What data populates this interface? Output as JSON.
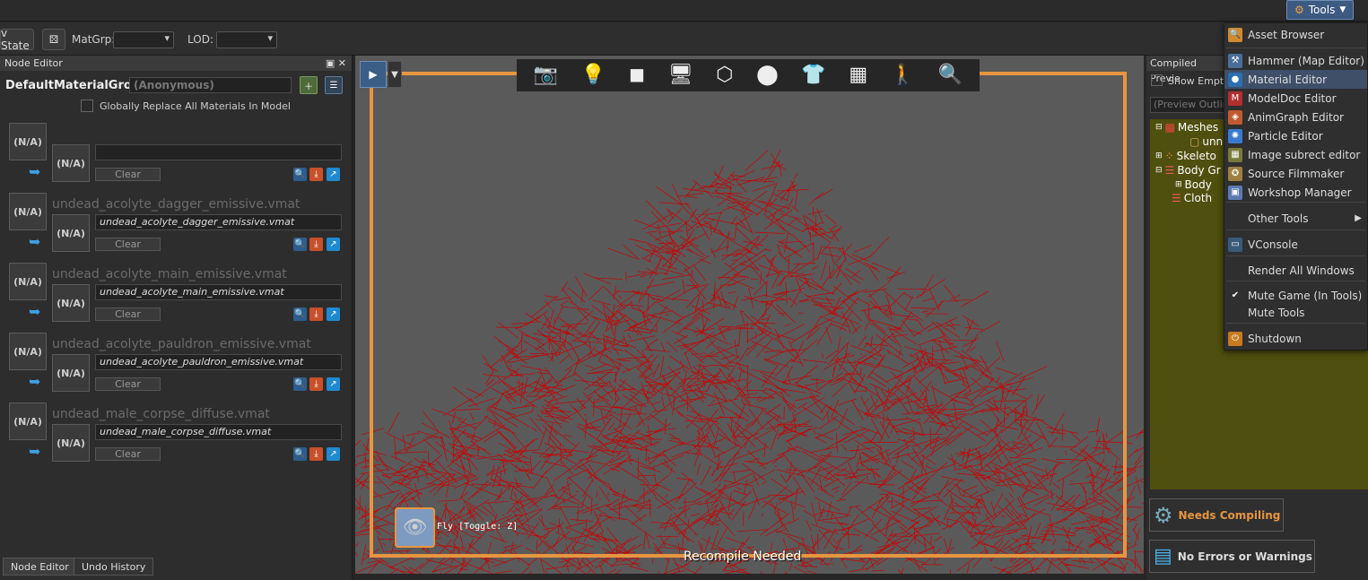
{
  "menubar": {
    "tools_label": "Tools"
  },
  "toolbar": {
    "state_label": "v State",
    "matgrp_label": "MatGrp:",
    "lod_label": "LOD:"
  },
  "node_editor": {
    "title": "Node Editor",
    "group_name": "DefaultMaterialGroup",
    "group_placeholder": "(Anonymous)",
    "replace_label": "Globally Replace All Materials In Model",
    "na_label": "(N/A)",
    "clear_label": "Clear",
    "entries": [
      {
        "name": "",
        "value": ""
      },
      {
        "name": "undead_acolyte_dagger_emissive.vmat",
        "value": "undead_acolyte_dagger_emissive.vmat"
      },
      {
        "name": "undead_acolyte_main_emissive.vmat",
        "value": "undead_acolyte_main_emissive.vmat"
      },
      {
        "name": "undead_acolyte_pauldron_emissive.vmat",
        "value": "undead_acolyte_pauldron_emissive.vmat"
      },
      {
        "name": "undead_male_corpse_diffuse.vmat",
        "value": "undead_male_corpse_diffuse.vmat"
      }
    ],
    "tabs": [
      "Node Editor",
      "Undo History"
    ]
  },
  "viewport": {
    "fly_label": "Fly [Toggle: Z]",
    "status": "Recompile Needed",
    "icons": [
      "camera-icon",
      "light-icon",
      "cube-icon",
      "monitor-icon",
      "wireframe-icon",
      "shapes-icon",
      "shirt-icon",
      "grid-icon",
      "figure-icon",
      "magnify-icon"
    ],
    "wire_color": "#cc0000",
    "frame_color": "#e8953f"
  },
  "right_panel": {
    "title": "Compiled Previe",
    "show_empty": "Show Empty",
    "outline_placeholder": "(Preview Outline",
    "tree": [
      "Meshes",
      "unn",
      "Skeleto",
      "Body Gr",
      "Body",
      "Cloth"
    ],
    "needs_compiling": "Needs Compiling",
    "no_errors": "No Errors or Warnings"
  },
  "tools_menu": {
    "items": [
      {
        "label": "Asset Browser",
        "icon": "magnifier-icon"
      },
      {
        "label": "Hammer (Map Editor)",
        "icon": "hammer-icon"
      },
      {
        "label": "Material Editor",
        "icon": "sphere-icon"
      },
      {
        "label": "ModelDoc Editor",
        "icon": "modeldoc-icon"
      },
      {
        "label": "AnimGraph Editor",
        "icon": "animgraph-icon"
      },
      {
        "label": "Particle Editor",
        "icon": "particle-icon"
      },
      {
        "label": "Image subrect editor",
        "icon": "subrect-icon"
      },
      {
        "label": "Source Filmmaker",
        "icon": "sfm-icon"
      },
      {
        "label": "Workshop Manager",
        "icon": "workshop-icon"
      },
      {
        "label": "Other Tools",
        "icon": ""
      },
      {
        "label": "VConsole",
        "icon": "vconsole-icon"
      },
      {
        "label": "Render All Windows",
        "icon": ""
      },
      {
        "label": "Mute Game (In Tools)",
        "icon": "check-icon"
      },
      {
        "label": "Mute Tools",
        "icon": ""
      },
      {
        "label": "Shutdown",
        "icon": "power-icon"
      }
    ]
  }
}
